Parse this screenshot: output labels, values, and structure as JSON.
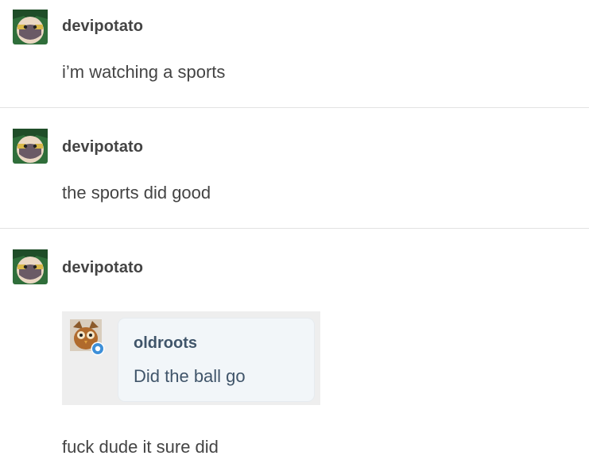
{
  "posts": [
    {
      "username": "devipotato",
      "text": "i’m watching a sports"
    },
    {
      "username": "devipotato",
      "text": "the sports did good"
    },
    {
      "username": "devipotato",
      "quote": {
        "username": "oldroots",
        "text": "Did the ball go"
      },
      "text": "fuck dude it sure did"
    }
  ],
  "colors": {
    "avatar_bg": "#2f6e3a",
    "avatar_mask": "#6a5a66",
    "quote_bubble": "#f2f6f9",
    "quote_text": "#40556a",
    "badge": "#3d8fd8"
  },
  "icons": [
    "devipotato-avatar",
    "oldroots-avatar",
    "reblog-badge-icon"
  ]
}
